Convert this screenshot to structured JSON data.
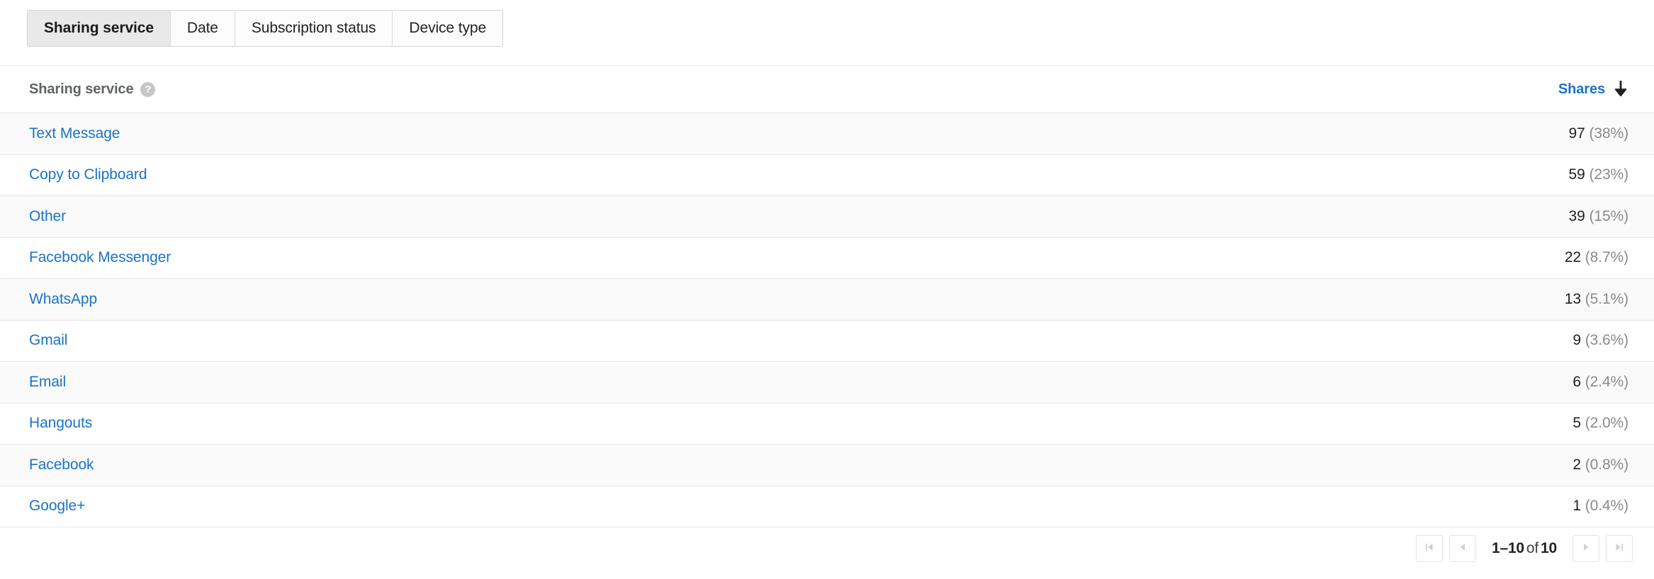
{
  "tabs": [
    {
      "label": "Sharing service",
      "active": true
    },
    {
      "label": "Date",
      "active": false
    },
    {
      "label": "Subscription status",
      "active": false
    },
    {
      "label": "Device type",
      "active": false
    }
  ],
  "table": {
    "header": {
      "dimension_label": "Sharing service",
      "help_icon": "help-icon",
      "metric_label": "Shares",
      "sort_icon": "arrow-down-icon",
      "sort_direction": "descending"
    },
    "columns": [
      "Sharing service",
      "Shares"
    ],
    "rows": [
      {
        "label": "Text Message",
        "count": "97",
        "percent": "(38%)"
      },
      {
        "label": "Copy to Clipboard",
        "count": "59",
        "percent": "(23%)"
      },
      {
        "label": "Other",
        "count": "39",
        "percent": "(15%)"
      },
      {
        "label": "Facebook Messenger",
        "count": "22",
        "percent": "(8.7%)"
      },
      {
        "label": "WhatsApp",
        "count": "13",
        "percent": "(5.1%)"
      },
      {
        "label": "Gmail",
        "count": "9",
        "percent": "(3.6%)"
      },
      {
        "label": "Email",
        "count": "6",
        "percent": "(2.4%)"
      },
      {
        "label": "Hangouts",
        "count": "5",
        "percent": "(2.0%)"
      },
      {
        "label": "Facebook",
        "count": "2",
        "percent": "(0.8%)"
      },
      {
        "label": "Google+",
        "count": "1",
        "percent": "(0.4%)"
      }
    ]
  },
  "pagination": {
    "range": "1–10",
    "of_label": "of",
    "total": "10",
    "first_icon": "first-page-icon",
    "prev_icon": "previous-page-icon",
    "next_icon": "next-page-icon",
    "last_icon": "last-page-icon"
  },
  "colors": {
    "link": "#1a73c8",
    "text": "#202124",
    "muted": "#8a8a8a",
    "row_alt": "#fafafa",
    "border": "#e6e6e6",
    "tab_active_bg": "#e9e9e9"
  }
}
